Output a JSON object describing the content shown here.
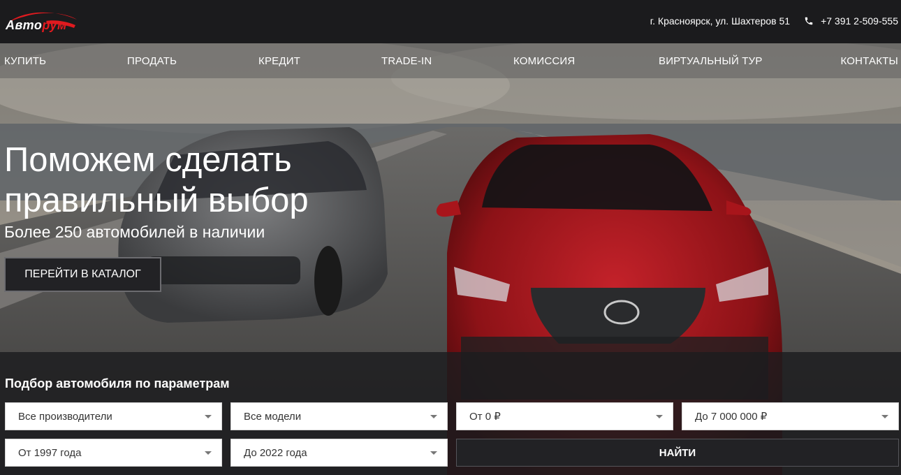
{
  "header": {
    "logo": {
      "text_part1": "Авто",
      "text_part2": "рум"
    },
    "address": "г. Красноярск, ул. Шахтеров 51",
    "phone": "+7 391 2-509-555",
    "phone_icon": "phone-icon"
  },
  "nav": {
    "items": [
      {
        "label": "КУПИТЬ"
      },
      {
        "label": "ПРОДАТЬ"
      },
      {
        "label": "КРЕДИТ"
      },
      {
        "label": "TRADE-IN"
      },
      {
        "label": "КОМИССИЯ"
      },
      {
        "label": "ВИРТУАЛЬНЫЙ ТУР"
      },
      {
        "label": "КОНТАКТЫ"
      }
    ]
  },
  "hero": {
    "title_line1": "Поможем сделать",
    "title_line2": "правильный выбор",
    "subtitle": "Более 250 автомобилей в наличии",
    "cta": "ПЕРЕЙТИ В КАТАЛОГ"
  },
  "filter": {
    "title": "Подбор автомобиля по параметрам",
    "manufacturer": "Все производители",
    "model": "Все модели",
    "price_from": "От 0 ₽",
    "price_to": "До 7 000 000 ₽",
    "year_from": "От 1997 года",
    "year_to": "До 2022 года",
    "search": "НАЙТИ"
  },
  "colors": {
    "accent_red": "#e01a1f",
    "header_bg": "#1b1b1d",
    "button_dark": "#222225"
  }
}
